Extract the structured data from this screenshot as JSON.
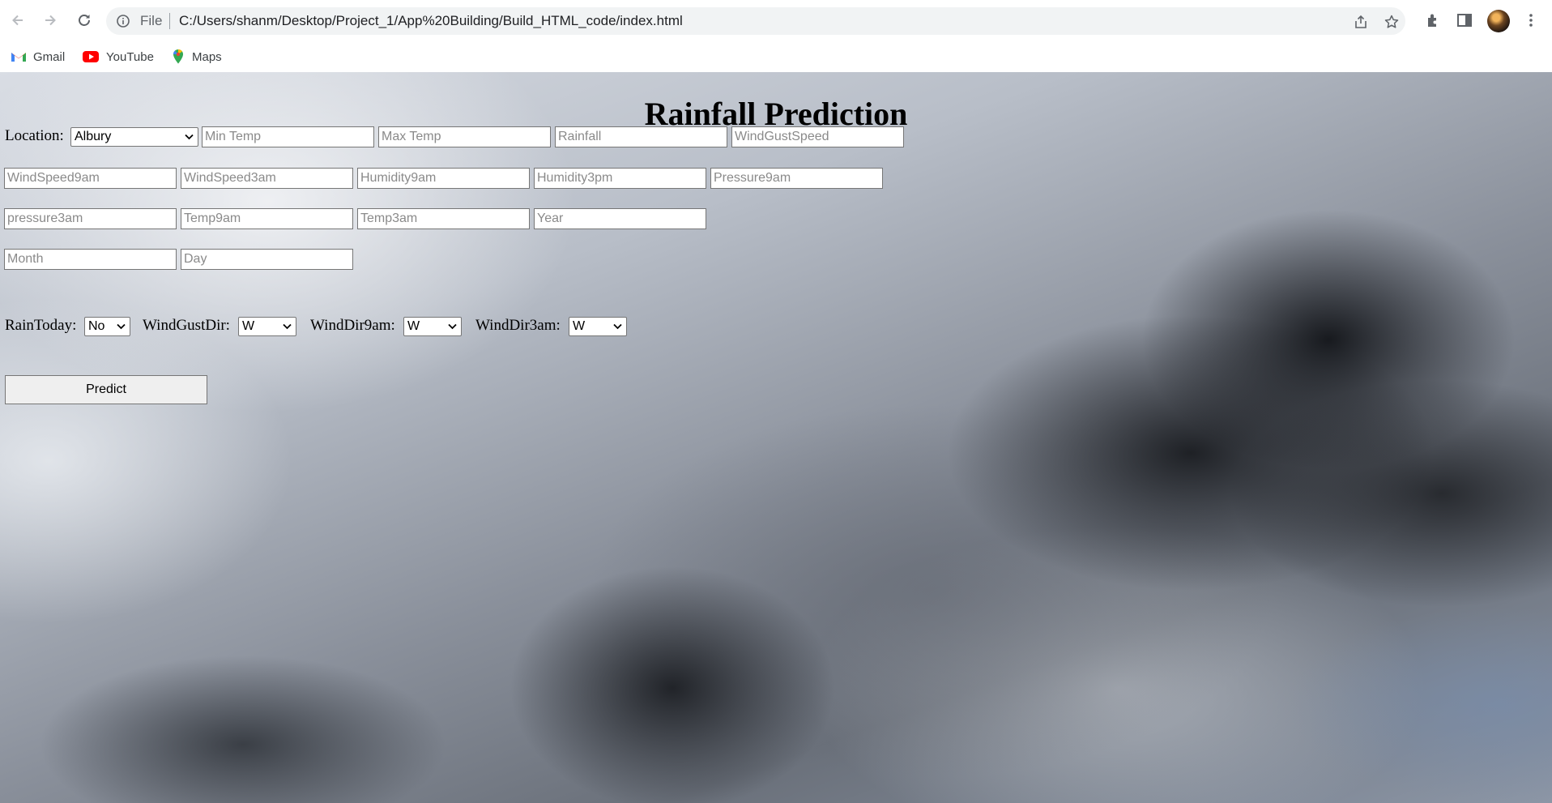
{
  "browser": {
    "scheme_label": "File",
    "url": "C:/Users/shanm/Desktop/Project_1/App%20Building/Build_HTML_code/index.html",
    "bookmarks": [
      {
        "label": "Gmail",
        "icon": "gmail-icon"
      },
      {
        "label": "YouTube",
        "icon": "youtube-icon"
      },
      {
        "label": "Maps",
        "icon": "maps-icon"
      }
    ]
  },
  "page": {
    "title": "Rainfall Prediction",
    "location_label": "Location:",
    "location_value": "Albury",
    "placeholders": {
      "min_temp": "Min Temp",
      "max_temp": "Max Temp",
      "rainfall": "Rainfall",
      "wind_gust_speed": "WindGustSpeed",
      "wind_speed_9am": "WindSpeed9am",
      "wind_speed_3am": "WindSpeed3am",
      "humidity_9am": "Humidity9am",
      "humidity_3pm": "Humidity3pm",
      "pressure_9am": "Pressure9am",
      "pressure_3am": "pressure3am",
      "temp_9am": "Temp9am",
      "temp_3am": "Temp3am",
      "year": "Year",
      "month": "Month",
      "day": "Day"
    },
    "rain_today_label": "RainToday:",
    "rain_today_value": "No",
    "wind_gust_dir_label": "WindGustDir:",
    "wind_gust_dir_value": "W",
    "wind_dir_9am_label": "WindDir9am:",
    "wind_dir_9am_value": "W",
    "wind_dir_3am_label": "WindDir3am:",
    "wind_dir_3am_value": "W",
    "predict_label": "Predict"
  }
}
